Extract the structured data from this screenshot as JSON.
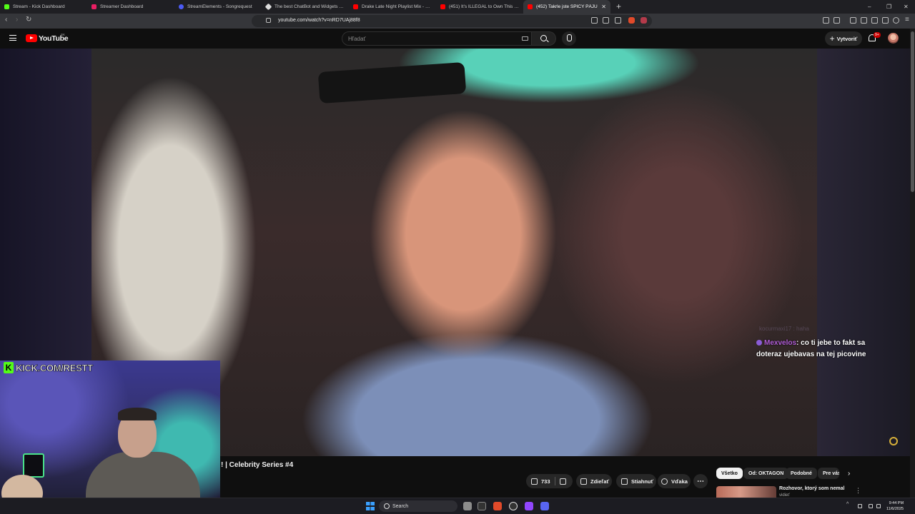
{
  "browser": {
    "tabs": [
      {
        "title": "Stream - Kick Dashboard",
        "color": "#53fc18"
      },
      {
        "title": "Streamer Dashboard",
        "color": "#e91e63"
      },
      {
        "title": "StreamElements - Songrequest",
        "color": "#4c5bf5"
      },
      {
        "title": "The best ChatBot and Widgets for K",
        "color": "#dddddd"
      },
      {
        "title": "Drake Late Night Playlist Mix - Comp",
        "color": "#ff0000"
      },
      {
        "title": "(451) It's ILLEGAL to Own This 90's H",
        "color": "#ff0000"
      },
      {
        "title": "(452) Takrle jste SPICY PÁJU",
        "color": "#ff0000",
        "active": true
      }
    ],
    "new_tab": "+",
    "close_tab": "✕",
    "window_controls": [
      "–",
      "❐",
      "✕"
    ],
    "url": "youtube.com/watch?v=nRD7UAj88f8",
    "nav": {
      "back": "‹",
      "forward": "›",
      "reload": "↻"
    }
  },
  "youtube": {
    "logo_text": "YouTube",
    "region": "SK",
    "search_placeholder": "Hľadať",
    "create_label": "Vytvoriť",
    "notification_badge": "9+"
  },
  "stream_overlay": {
    "kick_url": "KICK.COM/RESTT",
    "chat": {
      "faded_user": "kocurmaxi17",
      "faded_text": "haha",
      "user": "Mexvelos",
      "message": ": co ti jebe to fakt sa doteraz ujebavas na tej picovine"
    }
  },
  "video": {
    "title": "! | Celebrity Series #4"
  },
  "actions": {
    "likes": "733",
    "share": "Zdieľať",
    "download": "Stiahnuť",
    "thanks": "Vďaka",
    "more": "⋯"
  },
  "sidebar": {
    "chips": [
      "Všetko",
      "Od: OKTAGON",
      "Podobné",
      "Pre vás"
    ],
    "chip_next": "›",
    "recommendation": {
      "title": "Rozhovor, ktorý som nemal",
      "subtitle": "vidieť",
      "menu": "⋮"
    }
  },
  "taskbar": {
    "search": "Search",
    "time": "9:44 PM",
    "date": "11/6/2025"
  }
}
